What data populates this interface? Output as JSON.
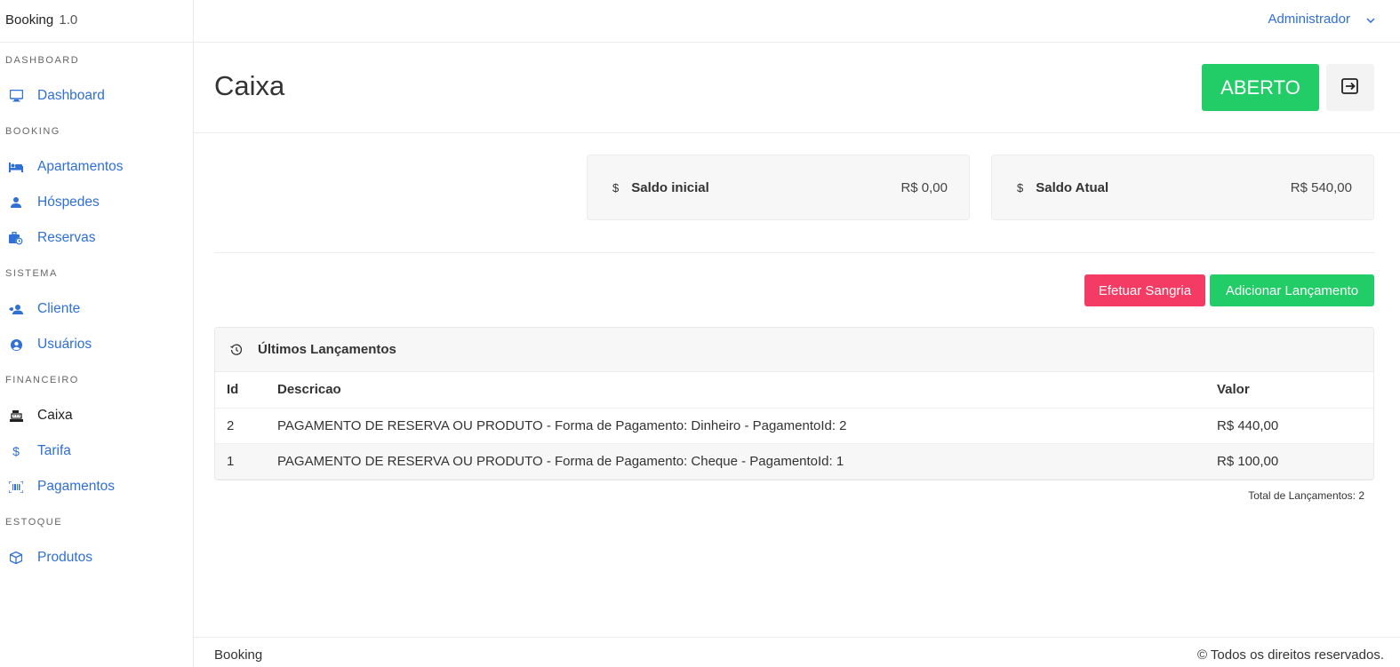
{
  "app": {
    "brand": "Booking",
    "version": "1.0"
  },
  "topbar": {
    "user": "Administrador"
  },
  "sidebar": {
    "sections": [
      {
        "title": "DASHBOARD",
        "items": [
          {
            "label": "Dashboard",
            "icon": "monitor-icon"
          }
        ]
      },
      {
        "title": "BOOKING",
        "items": [
          {
            "label": "Apartamentos",
            "icon": "bed-icon"
          },
          {
            "label": "Hóspedes",
            "icon": "user-icon"
          },
          {
            "label": "Reservas",
            "icon": "suitcase-clock-icon"
          }
        ]
      },
      {
        "title": "SISTEMA",
        "items": [
          {
            "label": "Cliente",
            "icon": "user-group-icon"
          },
          {
            "label": "Usuários",
            "icon": "user-circle-icon"
          }
        ]
      },
      {
        "title": "FINANCEIRO",
        "items": [
          {
            "label": "Caixa",
            "icon": "cash-register-icon"
          },
          {
            "label": "Tarifa",
            "icon": "dollar-icon"
          },
          {
            "label": "Pagamentos",
            "icon": "barcode-icon"
          }
        ]
      },
      {
        "title": "ESTOQUE",
        "items": [
          {
            "label": "Produtos",
            "icon": "box-icon"
          }
        ]
      }
    ]
  },
  "header": {
    "title": "Caixa",
    "status": "ABERTO"
  },
  "cards": [
    {
      "label": "Saldo inicial",
      "value": "R$ 0,00",
      "icon": "$"
    },
    {
      "label": "Saldo Atual",
      "value": "R$ 540,00",
      "icon": "$"
    }
  ],
  "actions": {
    "sangria": "Efetuar Sangria",
    "add": "Adicionar Lançamento"
  },
  "table": {
    "title": "Últimos Lançamentos",
    "columns": [
      "Id",
      "Descricao",
      "Valor"
    ],
    "rows": [
      [
        "2",
        "PAGAMENTO DE RESERVA OU PRODUTO - Forma de Pagamento: Dinheiro - PagamentoId: 2",
        "R$ 440,00"
      ],
      [
        "1",
        "PAGAMENTO DE RESERVA OU PRODUTO - Forma de Pagamento: Cheque - PagamentoId: 1",
        "R$ 100,00"
      ]
    ],
    "total": "Total de Lançamentos: 2"
  },
  "footer": {
    "left": "Booking",
    "right": "© Todos os direitos reservados."
  },
  "colors": {
    "primary": "#2f6fd6",
    "success": "#22cc66",
    "danger": "#f43b63"
  }
}
